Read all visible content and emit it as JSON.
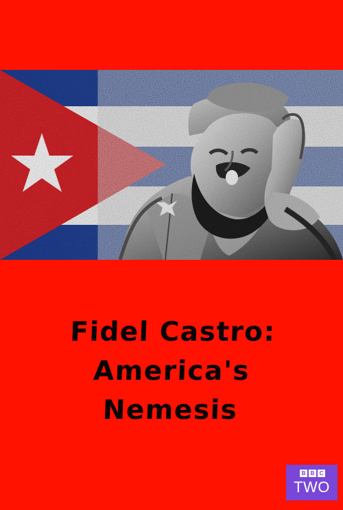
{
  "poster": {
    "background_color": "#ff1200",
    "title_lines": [
      "Fidel Castro:",
      "America's",
      "Nemesis"
    ],
    "title_color": "#080202",
    "hero_image": {
      "flag_icon": "cuban-flag-icon",
      "portrait_icon": "portrait-photo-icon"
    },
    "channel_badge": {
      "brand_letters": [
        "B",
        "B",
        "C"
      ],
      "channel_name": "TWO",
      "badge_color": "#7a46d8",
      "text_color": "#ffffff"
    }
  }
}
